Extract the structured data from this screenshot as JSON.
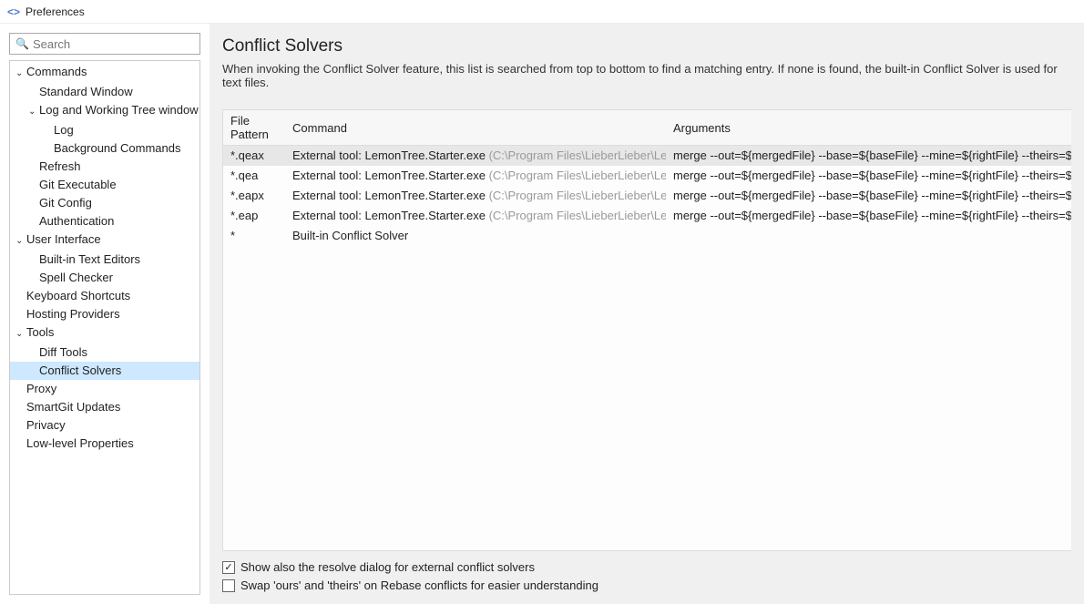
{
  "window": {
    "title": "Preferences"
  },
  "search": {
    "placeholder": "Search"
  },
  "tree": [
    {
      "label": "Commands",
      "level": 0,
      "expanded": true
    },
    {
      "label": "Standard Window",
      "level": 1
    },
    {
      "label": "Log and Working Tree window",
      "level": 1,
      "expanded": true
    },
    {
      "label": "Log",
      "level": 2
    },
    {
      "label": "Background Commands",
      "level": 2
    },
    {
      "label": "Refresh",
      "level": 1
    },
    {
      "label": "Git Executable",
      "level": 1
    },
    {
      "label": "Git Config",
      "level": 1
    },
    {
      "label": "Authentication",
      "level": 1
    },
    {
      "label": "User Interface",
      "level": 0,
      "expanded": true
    },
    {
      "label": "Built-in Text Editors",
      "level": 1
    },
    {
      "label": "Spell Checker",
      "level": 1
    },
    {
      "label": "Keyboard Shortcuts",
      "level": 0
    },
    {
      "label": "Hosting Providers",
      "level": 0
    },
    {
      "label": "Tools",
      "level": 0,
      "expanded": true
    },
    {
      "label": "Diff Tools",
      "level": 1
    },
    {
      "label": "Conflict Solvers",
      "level": 1,
      "selected": true
    },
    {
      "label": "Proxy",
      "level": 0
    },
    {
      "label": "SmartGit Updates",
      "level": 0
    },
    {
      "label": "Privacy",
      "level": 0
    },
    {
      "label": "Low-level Properties",
      "level": 0
    }
  ],
  "page": {
    "title": "Conflict Solvers",
    "description": "When invoking the Conflict Solver feature, this list is searched from top to bottom to find a matching entry. If none is found, the built-in Conflict Solver is used for text files."
  },
  "table": {
    "headers": {
      "pattern": "File Pattern",
      "command": "Command",
      "arguments": "Arguments"
    },
    "rows": [
      {
        "pattern": "*.qeax",
        "cmd_prefix": "External tool: LemonTree.Starter.exe ",
        "cmd_path": "(C:\\Program Files\\LieberLieber\\LemonTree)",
        "args": "merge --out=${mergedFile} --base=${baseFile} --mine=${rightFile} --theirs=${leftFile}",
        "selected": true
      },
      {
        "pattern": "*.qea",
        "cmd_prefix": "External tool: LemonTree.Starter.exe ",
        "cmd_path": "(C:\\Program Files\\LieberLieber\\LemonTree)",
        "args": "merge --out=${mergedFile} --base=${baseFile} --mine=${rightFile} --theirs=${leftFile}"
      },
      {
        "pattern": "*.eapx",
        "cmd_prefix": "External tool: LemonTree.Starter.exe ",
        "cmd_path": "(C:\\Program Files\\LieberLieber\\LemonTree)",
        "args": "merge --out=${mergedFile} --base=${baseFile} --mine=${rightFile} --theirs=${leftFile}"
      },
      {
        "pattern": "*.eap",
        "cmd_prefix": "External tool: LemonTree.Starter.exe ",
        "cmd_path": "(C:\\Program Files\\LieberLieber\\LemonTree)",
        "args": "merge --out=${mergedFile} --base=${baseFile} --mine=${rightFile} --theirs=${leftFile}"
      },
      {
        "pattern": "*",
        "cmd_prefix": "Built-in Conflict Solver",
        "cmd_path": "",
        "args": ""
      }
    ]
  },
  "checks": {
    "show_dialog": {
      "label": "Show also the resolve dialog for external conflict solvers",
      "checked": true
    },
    "swap": {
      "label": "Swap 'ours' and 'theirs' on Rebase conflicts for easier understanding",
      "checked": false
    }
  }
}
